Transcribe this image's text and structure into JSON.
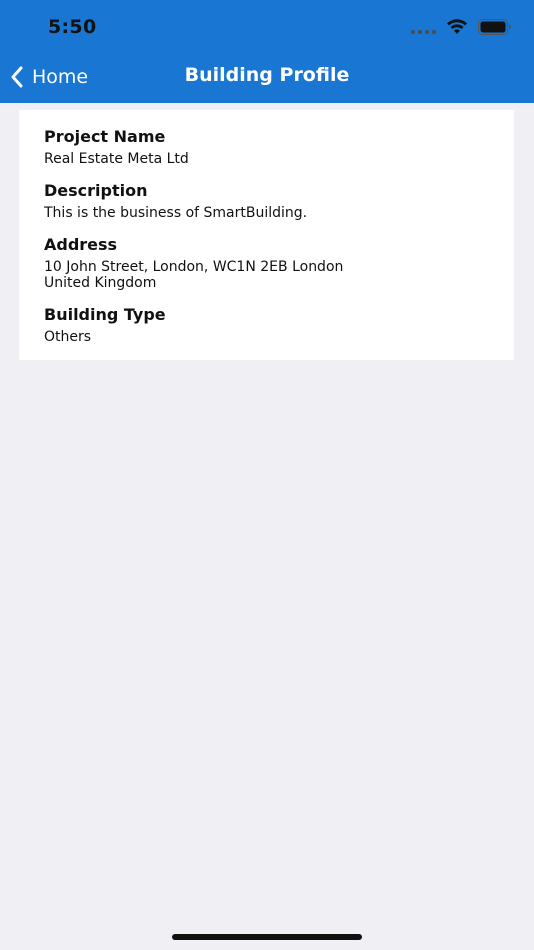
{
  "status_bar": {
    "time": "5:50",
    "icons": [
      "signal-dots-icon",
      "wifi-icon",
      "battery-icon"
    ]
  },
  "nav": {
    "back_label": "Home",
    "title": "Building Profile",
    "background_color": "#1976d2"
  },
  "profile": {
    "fields": [
      {
        "label": "Project Name",
        "value": "Real Estate Meta Ltd"
      },
      {
        "label": "Description",
        "value": "This is the business of SmartBuilding."
      },
      {
        "label": "Address",
        "value_line1": "10 John Street, London, WC1N 2EB London",
        "value_line2": "United Kingdom"
      },
      {
        "label": "Building Type",
        "value": "Others"
      }
    ]
  }
}
